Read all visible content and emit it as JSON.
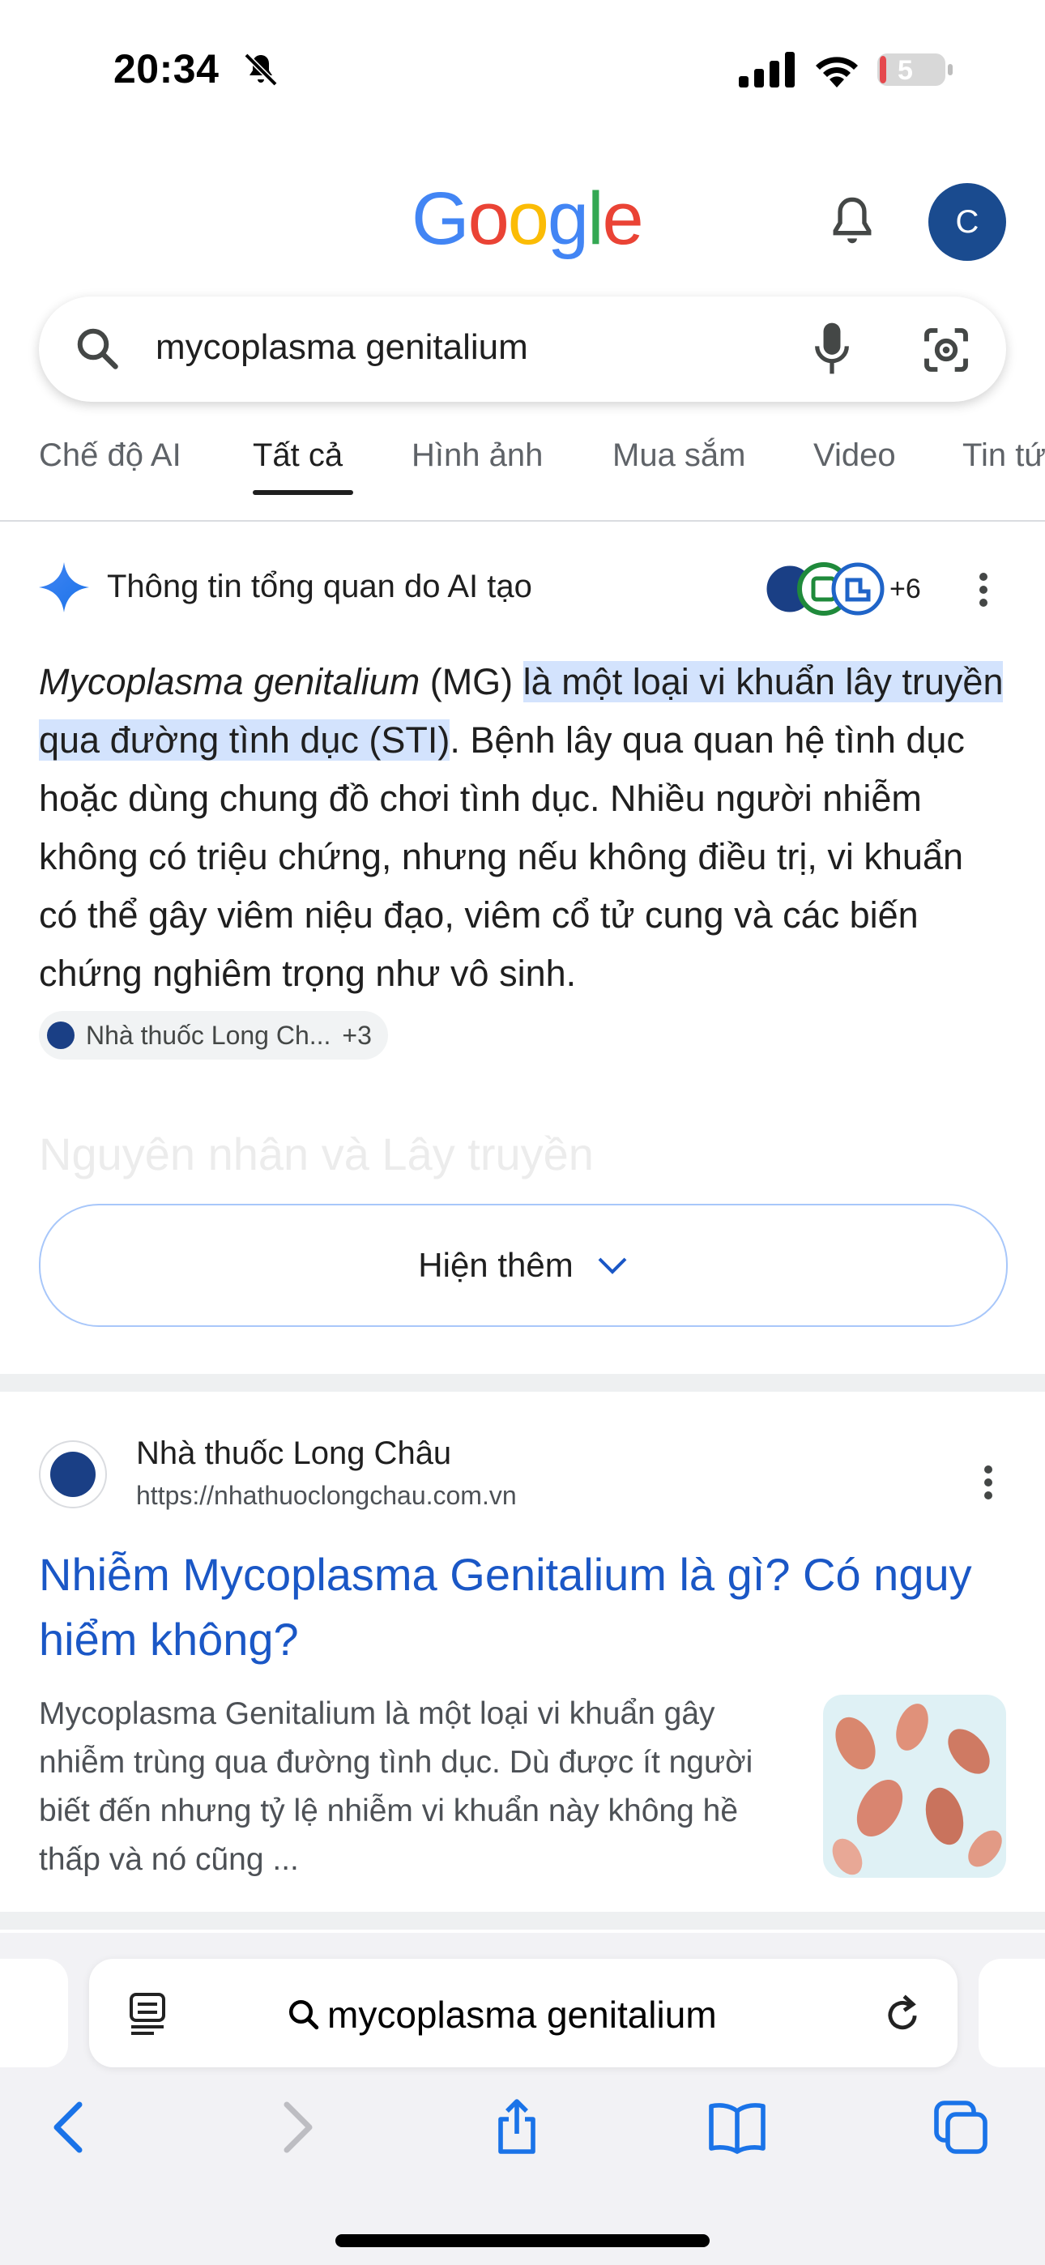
{
  "status_bar": {
    "time": "20:34",
    "battery": "5"
  },
  "header": {
    "logo": [
      "G",
      "o",
      "o",
      "g",
      "l",
      "e"
    ],
    "avatar_letter": "C"
  },
  "search": {
    "query": "mycoplasma genitalium"
  },
  "tabs": [
    "Chế độ AI",
    "Tất cả",
    "Hình ảnh",
    "Mua sắm",
    "Video",
    "Tin tứ"
  ],
  "ai_overview": {
    "title": "Thông tin tổng quan do AI tạo",
    "sources_more": "+6",
    "body_italic": "Mycoplasma genitalium",
    "body_abbr": " (MG) ",
    "body_highlight": "là một loại vi khuẩn lây truyền qua đường tình dục (STI)",
    "body_rest": ". Bệnh lây qua quan hệ tình dục hoặc dùng chung đồ chơi tình dục. Nhiều người nhiễm không có triệu chứng, nhưng nếu không điều trị, vi khuẩn có thể gây viêm niệu đạo, viêm cổ tử cung và các biến chứng nghiêm trọng như vô sinh.",
    "chip_label": "Nhà thuốc Long Ch...",
    "chip_more": "+3",
    "faded_heading": "Nguyên nhân và Lây truyền",
    "show_more": "Hiện thêm"
  },
  "result": {
    "site_name": "Nhà thuốc Long Châu",
    "url": "https://nhathuoclongchau.com.vn",
    "title": "Nhiễm Mycoplasma Genitalium là gì? Có nguy hiểm không?",
    "snippet": "Mycoplasma Genitalium là một loại vi khuẩn gây nhiễm trùng qua đường tình dục. Dù được ít người biết đến nhưng tỷ lệ nhiễm vi khuẩn này không hề thấp và nó cũng ..."
  },
  "safari": {
    "url_text": "mycoplasma genitalium"
  },
  "colors": {
    "accent_blue": "#1a57c6",
    "highlight": "#d3e3fd",
    "avatar": "#1a4b8f"
  }
}
